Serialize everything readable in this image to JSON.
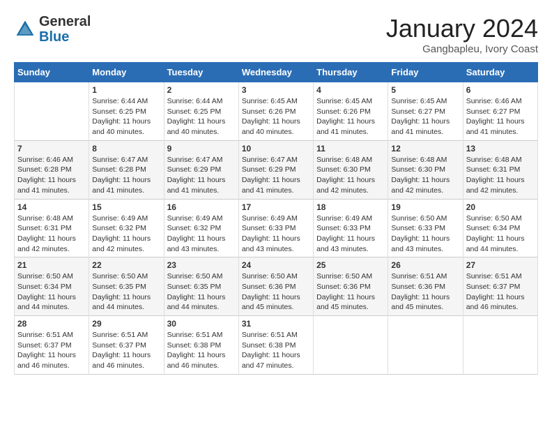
{
  "logo": {
    "general": "General",
    "blue": "Blue"
  },
  "header": {
    "month": "January 2024",
    "location": "Gangbapleu, Ivory Coast"
  },
  "days_of_week": [
    "Sunday",
    "Monday",
    "Tuesday",
    "Wednesday",
    "Thursday",
    "Friday",
    "Saturday"
  ],
  "weeks": [
    [
      {
        "day": "",
        "sunrise": "",
        "sunset": "",
        "daylight": ""
      },
      {
        "day": "1",
        "sunrise": "Sunrise: 6:44 AM",
        "sunset": "Sunset: 6:25 PM",
        "daylight": "Daylight: 11 hours and 40 minutes."
      },
      {
        "day": "2",
        "sunrise": "Sunrise: 6:44 AM",
        "sunset": "Sunset: 6:25 PM",
        "daylight": "Daylight: 11 hours and 40 minutes."
      },
      {
        "day": "3",
        "sunrise": "Sunrise: 6:45 AM",
        "sunset": "Sunset: 6:26 PM",
        "daylight": "Daylight: 11 hours and 40 minutes."
      },
      {
        "day": "4",
        "sunrise": "Sunrise: 6:45 AM",
        "sunset": "Sunset: 6:26 PM",
        "daylight": "Daylight: 11 hours and 41 minutes."
      },
      {
        "day": "5",
        "sunrise": "Sunrise: 6:45 AM",
        "sunset": "Sunset: 6:27 PM",
        "daylight": "Daylight: 11 hours and 41 minutes."
      },
      {
        "day": "6",
        "sunrise": "Sunrise: 6:46 AM",
        "sunset": "Sunset: 6:27 PM",
        "daylight": "Daylight: 11 hours and 41 minutes."
      }
    ],
    [
      {
        "day": "7",
        "sunrise": "Sunrise: 6:46 AM",
        "sunset": "Sunset: 6:28 PM",
        "daylight": "Daylight: 11 hours and 41 minutes."
      },
      {
        "day": "8",
        "sunrise": "Sunrise: 6:47 AM",
        "sunset": "Sunset: 6:28 PM",
        "daylight": "Daylight: 11 hours and 41 minutes."
      },
      {
        "day": "9",
        "sunrise": "Sunrise: 6:47 AM",
        "sunset": "Sunset: 6:29 PM",
        "daylight": "Daylight: 11 hours and 41 minutes."
      },
      {
        "day": "10",
        "sunrise": "Sunrise: 6:47 AM",
        "sunset": "Sunset: 6:29 PM",
        "daylight": "Daylight: 11 hours and 41 minutes."
      },
      {
        "day": "11",
        "sunrise": "Sunrise: 6:48 AM",
        "sunset": "Sunset: 6:30 PM",
        "daylight": "Daylight: 11 hours and 42 minutes."
      },
      {
        "day": "12",
        "sunrise": "Sunrise: 6:48 AM",
        "sunset": "Sunset: 6:30 PM",
        "daylight": "Daylight: 11 hours and 42 minutes."
      },
      {
        "day": "13",
        "sunrise": "Sunrise: 6:48 AM",
        "sunset": "Sunset: 6:31 PM",
        "daylight": "Daylight: 11 hours and 42 minutes."
      }
    ],
    [
      {
        "day": "14",
        "sunrise": "Sunrise: 6:48 AM",
        "sunset": "Sunset: 6:31 PM",
        "daylight": "Daylight: 11 hours and 42 minutes."
      },
      {
        "day": "15",
        "sunrise": "Sunrise: 6:49 AM",
        "sunset": "Sunset: 6:32 PM",
        "daylight": "Daylight: 11 hours and 42 minutes."
      },
      {
        "day": "16",
        "sunrise": "Sunrise: 6:49 AM",
        "sunset": "Sunset: 6:32 PM",
        "daylight": "Daylight: 11 hours and 43 minutes."
      },
      {
        "day": "17",
        "sunrise": "Sunrise: 6:49 AM",
        "sunset": "Sunset: 6:33 PM",
        "daylight": "Daylight: 11 hours and 43 minutes."
      },
      {
        "day": "18",
        "sunrise": "Sunrise: 6:49 AM",
        "sunset": "Sunset: 6:33 PM",
        "daylight": "Daylight: 11 hours and 43 minutes."
      },
      {
        "day": "19",
        "sunrise": "Sunrise: 6:50 AM",
        "sunset": "Sunset: 6:33 PM",
        "daylight": "Daylight: 11 hours and 43 minutes."
      },
      {
        "day": "20",
        "sunrise": "Sunrise: 6:50 AM",
        "sunset": "Sunset: 6:34 PM",
        "daylight": "Daylight: 11 hours and 44 minutes."
      }
    ],
    [
      {
        "day": "21",
        "sunrise": "Sunrise: 6:50 AM",
        "sunset": "Sunset: 6:34 PM",
        "daylight": "Daylight: 11 hours and 44 minutes."
      },
      {
        "day": "22",
        "sunrise": "Sunrise: 6:50 AM",
        "sunset": "Sunset: 6:35 PM",
        "daylight": "Daylight: 11 hours and 44 minutes."
      },
      {
        "day": "23",
        "sunrise": "Sunrise: 6:50 AM",
        "sunset": "Sunset: 6:35 PM",
        "daylight": "Daylight: 11 hours and 44 minutes."
      },
      {
        "day": "24",
        "sunrise": "Sunrise: 6:50 AM",
        "sunset": "Sunset: 6:36 PM",
        "daylight": "Daylight: 11 hours and 45 minutes."
      },
      {
        "day": "25",
        "sunrise": "Sunrise: 6:50 AM",
        "sunset": "Sunset: 6:36 PM",
        "daylight": "Daylight: 11 hours and 45 minutes."
      },
      {
        "day": "26",
        "sunrise": "Sunrise: 6:51 AM",
        "sunset": "Sunset: 6:36 PM",
        "daylight": "Daylight: 11 hours and 45 minutes."
      },
      {
        "day": "27",
        "sunrise": "Sunrise: 6:51 AM",
        "sunset": "Sunset: 6:37 PM",
        "daylight": "Daylight: 11 hours and 46 minutes."
      }
    ],
    [
      {
        "day": "28",
        "sunrise": "Sunrise: 6:51 AM",
        "sunset": "Sunset: 6:37 PM",
        "daylight": "Daylight: 11 hours and 46 minutes."
      },
      {
        "day": "29",
        "sunrise": "Sunrise: 6:51 AM",
        "sunset": "Sunset: 6:37 PM",
        "daylight": "Daylight: 11 hours and 46 minutes."
      },
      {
        "day": "30",
        "sunrise": "Sunrise: 6:51 AM",
        "sunset": "Sunset: 6:38 PM",
        "daylight": "Daylight: 11 hours and 46 minutes."
      },
      {
        "day": "31",
        "sunrise": "Sunrise: 6:51 AM",
        "sunset": "Sunset: 6:38 PM",
        "daylight": "Daylight: 11 hours and 47 minutes."
      },
      {
        "day": "",
        "sunrise": "",
        "sunset": "",
        "daylight": ""
      },
      {
        "day": "",
        "sunrise": "",
        "sunset": "",
        "daylight": ""
      },
      {
        "day": "",
        "sunrise": "",
        "sunset": "",
        "daylight": ""
      }
    ]
  ]
}
